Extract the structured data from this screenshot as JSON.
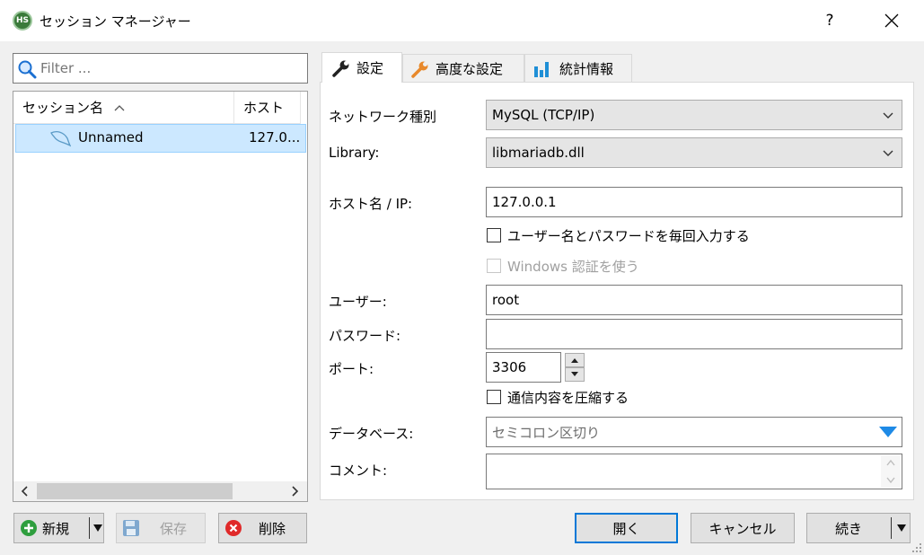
{
  "window": {
    "title": "セッション マネージャー",
    "app_icon_text": "HS",
    "help_label": "?"
  },
  "filter": {
    "placeholder": "Filter ..."
  },
  "session_list": {
    "columns": [
      "セッション名",
      "ホスト"
    ],
    "rows": [
      {
        "name": "Unnamed",
        "host": "127.0..."
      }
    ]
  },
  "tabs": [
    "設定",
    "高度な設定",
    "統計情報"
  ],
  "form": {
    "network_type_label": "ネットワーク種別",
    "network_type_value": "MySQL (TCP/IP)",
    "library_label": "Library:",
    "library_value": "libmariadb.dll",
    "host_label": "ホスト名 / IP:",
    "host_value": "127.0.0.1",
    "prompt_credentials_label": "ユーザー名とパスワードを毎回入力する",
    "windows_auth_label": "Windows 認証を使う",
    "user_label": "ユーザー:",
    "user_value": "root",
    "password_label": "パスワード:",
    "password_value": "",
    "port_label": "ポート:",
    "port_value": "3306",
    "compress_label": "通信内容を圧縮する",
    "database_label": "データベース:",
    "database_placeholder": "セミコロン区切り",
    "comment_label": "コメント:",
    "comment_value": ""
  },
  "buttons": {
    "new": "新規",
    "save": "保存",
    "delete": "削除",
    "open": "開く",
    "cancel": "キャンセル",
    "more": "続き"
  },
  "colors": {
    "selection_bg": "#cce8ff",
    "accent_blue": "#0078d7",
    "new_icon_green": "#2e9e3e",
    "delete_icon_red": "#e02a2a",
    "wrench_orange": "#e8892b"
  }
}
